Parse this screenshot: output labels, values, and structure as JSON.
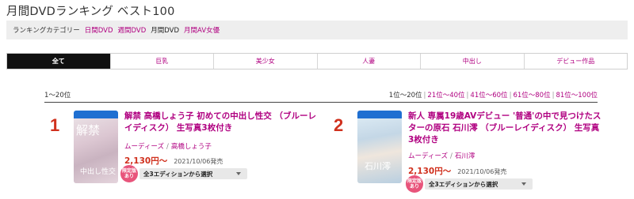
{
  "page": {
    "title": "月間DVDランキング ベスト100"
  },
  "categories": {
    "label": "ランキングカテゴリー",
    "items": [
      {
        "label": "日間DVD",
        "active": false
      },
      {
        "label": "週間DVD",
        "active": false
      },
      {
        "label": "月間DVD",
        "active": true
      },
      {
        "label": "月間AV女優",
        "active": false
      }
    ]
  },
  "tabs": [
    {
      "label": "全て",
      "selected": true
    },
    {
      "label": "巨乳",
      "selected": false
    },
    {
      "label": "美少女",
      "selected": false
    },
    {
      "label": "人妻",
      "selected": false
    },
    {
      "label": "中出し",
      "selected": false
    },
    {
      "label": "デビュー作品",
      "selected": false
    }
  ],
  "ranking_range": {
    "current": "1〜20位",
    "links": [
      "1位〜20位",
      "21位〜40位",
      "41位〜60位",
      "61位〜80位",
      "81位〜100位"
    ],
    "separator": "|"
  },
  "items": [
    {
      "rank": "1",
      "title": "解禁 高橋しょう子 初めての中出し性交 （ブルーレイディスク） 生写真3枚付き",
      "studio": "ムーディーズ",
      "actress": "高橋しょう子",
      "price": "2,130円〜",
      "release": "2021/10/06発売",
      "badge": "限定版 あり",
      "edition_select": "全3エディションから選択",
      "cover_text_top": "解禁",
      "cover_text_bottom": "中出し性交"
    },
    {
      "rank": "2",
      "title": "新人 専属19歳AVデビュー '普通'の中で見つけたスターの原石 石川澪 （ブルーレイディスク） 生写真3枚付き",
      "studio": "ムーディーズ",
      "actress": "石川澪",
      "price": "2,130円〜",
      "release": "2021/10/06発売",
      "badge": "限定版 あり",
      "edition_select": "全3エディションから選択",
      "cover_text_bottom": "石川澪"
    }
  ],
  "colors": {
    "accent": "#b00080",
    "price": "#d0311e",
    "badge": "#e8547b",
    "tab_active_bg": "#111111"
  }
}
